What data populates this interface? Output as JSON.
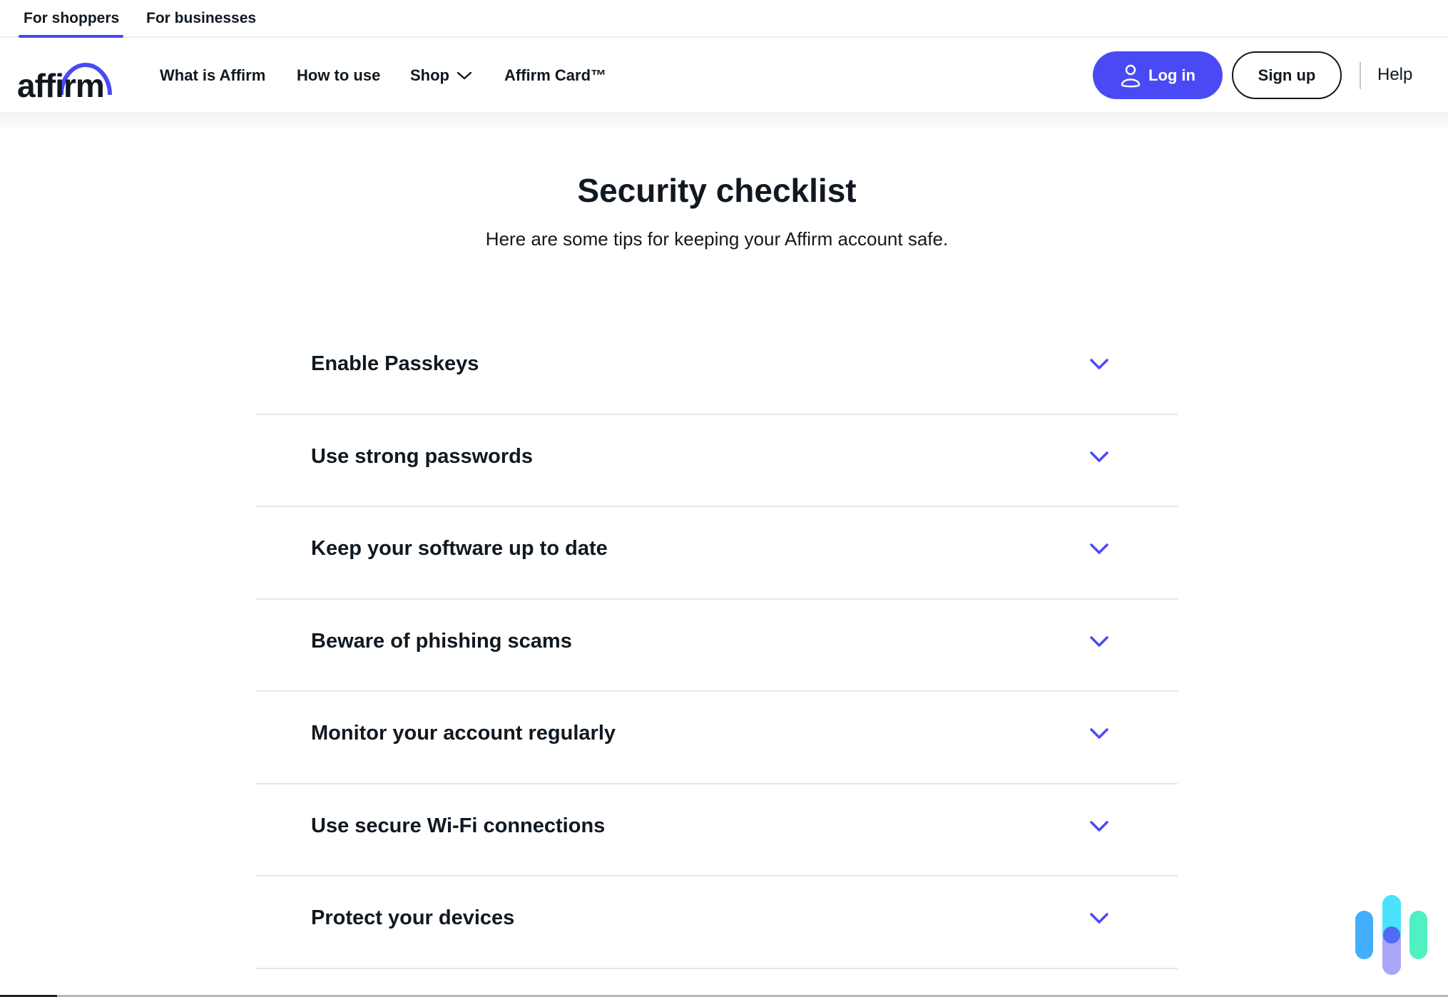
{
  "audience_tabs": [
    {
      "label": "For shoppers",
      "active": true
    },
    {
      "label": "For businesses",
      "active": false
    }
  ],
  "brand": {
    "logo_text": "affirm",
    "accent_color": "#4a4af4"
  },
  "nav": {
    "links": [
      {
        "label": "What is Affirm"
      },
      {
        "label": "How to use"
      },
      {
        "label": "Shop",
        "icon": "chevron-down-icon"
      },
      {
        "label": "Affirm Card™"
      }
    ],
    "login_label": "Log in",
    "login_icon": "user-icon",
    "signup_label": "Sign up",
    "help_label": "Help"
  },
  "page": {
    "title": "Security checklist",
    "subtitle": "Here are some tips for keeping your Affirm account safe."
  },
  "checklist": {
    "items": [
      {
        "label": "Enable Passkeys",
        "expanded": false
      },
      {
        "label": "Use strong passwords",
        "expanded": false
      },
      {
        "label": "Keep your software up to date",
        "expanded": false
      },
      {
        "label": "Beware of phishing scams",
        "expanded": false
      },
      {
        "label": "Monitor your account regularly",
        "expanded": false
      },
      {
        "label": "Use secure Wi-Fi connections",
        "expanded": false
      },
      {
        "label": "Protect your devices",
        "expanded": false
      }
    ]
  },
  "widget": {
    "icon": "chat-widget-icon",
    "colors": [
      "#42aefc",
      "#49e3fb",
      "#aaa6f8",
      "#4f6af3",
      "#4ff0c2"
    ]
  }
}
